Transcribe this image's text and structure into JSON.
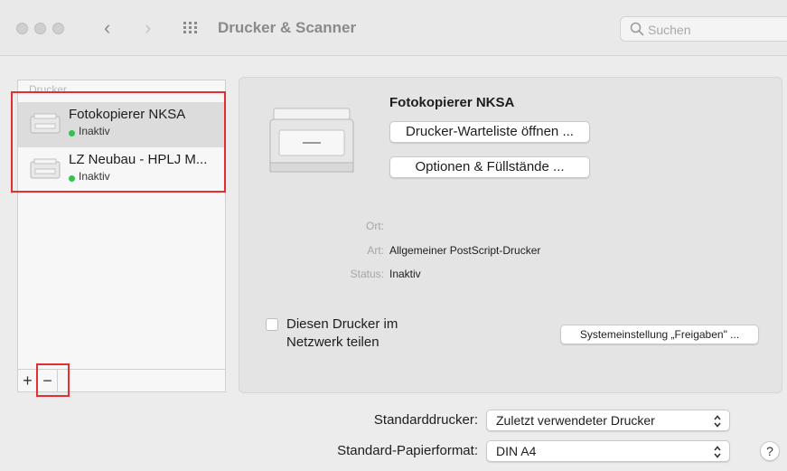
{
  "window": {
    "title": "Drucker & Scanner",
    "back_icon": "chevron-left-icon",
    "forward_icon": "chevron-right-icon",
    "grid_icon": "show-all-grid-icon"
  },
  "search": {
    "placeholder": "Suchen",
    "value": ""
  },
  "sidebar": {
    "header": "Drucker",
    "printers": [
      {
        "name": "Fotokopierer NKSA",
        "status": "Inaktiv",
        "status_color": "#35c152",
        "selected": true
      },
      {
        "name": "LZ Neubau - HPLJ M...",
        "status": "Inaktiv",
        "status_color": "#35c152",
        "selected": false
      }
    ],
    "add_label": "+",
    "remove_label": "−"
  },
  "detail": {
    "printer_name": "Fotokopierer NKSA",
    "queue_button": "Drucker-Warteliste öffnen ...",
    "options_button": "Optionen & Füllstände ...",
    "location_label": "Ort:",
    "location_value": "",
    "kind_label": "Art:",
    "kind_value": "Allgemeiner PostScript-Drucker",
    "status_label": "Status:",
    "status_value": "Inaktiv",
    "share_label": "Diesen Drucker im Netzwerk teilen",
    "share_checked": false,
    "sharing_prefs_button": "Systemeinstellung „Freigaben\" ..."
  },
  "defaults": {
    "default_printer_label": "Standarddrucker:",
    "default_printer_value": "Zuletzt verwendeter Drucker",
    "paper_size_label": "Standard-Papierformat:",
    "paper_size_value": "DIN A4"
  },
  "help_label": "?",
  "highlight_color": "#e03030"
}
